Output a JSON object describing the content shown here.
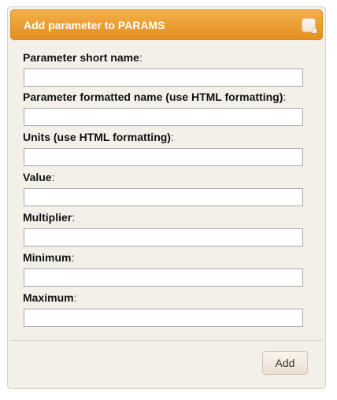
{
  "dialog": {
    "title": "Add parameter to PARAMS",
    "close_icon": "close-icon"
  },
  "fields": [
    {
      "label": "Parameter short name",
      "value": ""
    },
    {
      "label": "Parameter formatted name (use HTML formatting)",
      "value": ""
    },
    {
      "label": "Units (use HTML formatting)",
      "value": ""
    },
    {
      "label": "Value",
      "value": ""
    },
    {
      "label": "Multiplier",
      "value": ""
    },
    {
      "label": "Minimum",
      "value": ""
    },
    {
      "label": "Maximum",
      "value": ""
    }
  ],
  "label_suffix": ":",
  "actions": {
    "add_label": "Add"
  },
  "colors": {
    "titlebar": "#eca035",
    "dialog_bg": "#f3f0ea",
    "title_text": "#ffffff"
  }
}
